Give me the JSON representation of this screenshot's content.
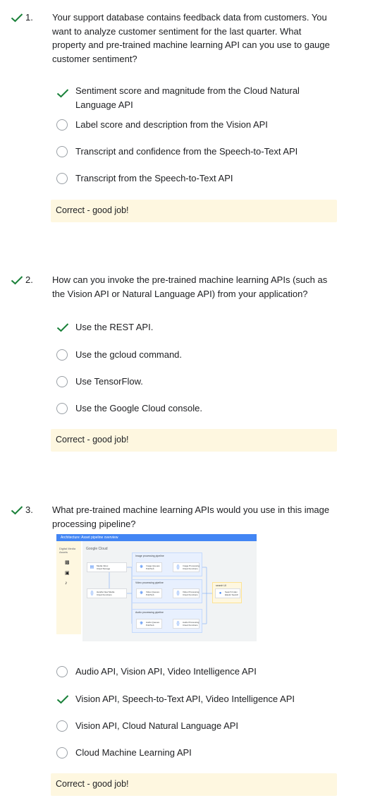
{
  "colors": {
    "check_green": "#188038",
    "feedback_bg": "#fef7e0",
    "radio_border": "#9aa0a6",
    "diagram_header": "#4285f4"
  },
  "questions": [
    {
      "number": "1.",
      "text": "Your support database contains feedback data from customers. You want to analyze customer sentiment for the last quarter. What property and pre-trained machine learning API can you use to gauge customer sentiment?",
      "options": [
        {
          "label": "Sentiment score and magnitude from the Cloud Natural Language API",
          "selected_correct": true
        },
        {
          "label": "Label score and description from the Vision API",
          "selected_correct": false
        },
        {
          "label": "Transcript and confidence from the Speech-to-Text API",
          "selected_correct": false
        },
        {
          "label": "Transcript from the Speech-to-Text API",
          "selected_correct": false
        }
      ],
      "feedback": "Correct - good job!"
    },
    {
      "number": "2.",
      "text": "How can you invoke the pre-trained machine learning APIs (such as the Vision API or Natural Language API) from your application?",
      "options": [
        {
          "label": "Use the REST API.",
          "selected_correct": true
        },
        {
          "label": "Use the gcloud command.",
          "selected_correct": false
        },
        {
          "label": "Use TensorFlow.",
          "selected_correct": false
        },
        {
          "label": "Use the Google Cloud console.",
          "selected_correct": false
        }
      ],
      "feedback": "Correct - good job!"
    },
    {
      "number": "3.",
      "text": "What pre-trained machine learning APIs would you use in this image processing pipeline?",
      "options": [
        {
          "label": "Audio API, Vision API, Video Intelligence API",
          "selected_correct": false
        },
        {
          "label": "Vision API, Speech-to-Text API, Video Intelligence API",
          "selected_correct": true
        },
        {
          "label": "Vision API, Cloud Natural Language API",
          "selected_correct": false
        },
        {
          "label": "Cloud Machine Learning API",
          "selected_correct": false
        }
      ],
      "feedback": "Correct - good job!"
    }
  ],
  "diagram": {
    "header": "Architecture: Asset pipeline overview",
    "left_label": "Digital Media Assets",
    "brand": "Google Cloud",
    "lanes": {
      "image": "Image processing pipeline",
      "video": "Video processing pipeline",
      "audio": "Audio processing pipeline"
    },
    "nodes": {
      "media_inbox": "Media Inbox\nCloud Storage",
      "handle_new_media": "Handle New Media\nCloud Functions",
      "image_queue": "Image Queues\nPub/Sub",
      "image_processing": "Image Processing\nCloud Functions",
      "video_queue": "Video Queues\nPub/Sub",
      "video_processing": "Video Processing\nCloud Functions",
      "audio_queue": "Audio Queues\nPub/Sub",
      "audio_processing": "Audio Processing\nCloud Functions",
      "search_index": "Search Index\nElastic Search",
      "search_ui": "search UI"
    }
  }
}
